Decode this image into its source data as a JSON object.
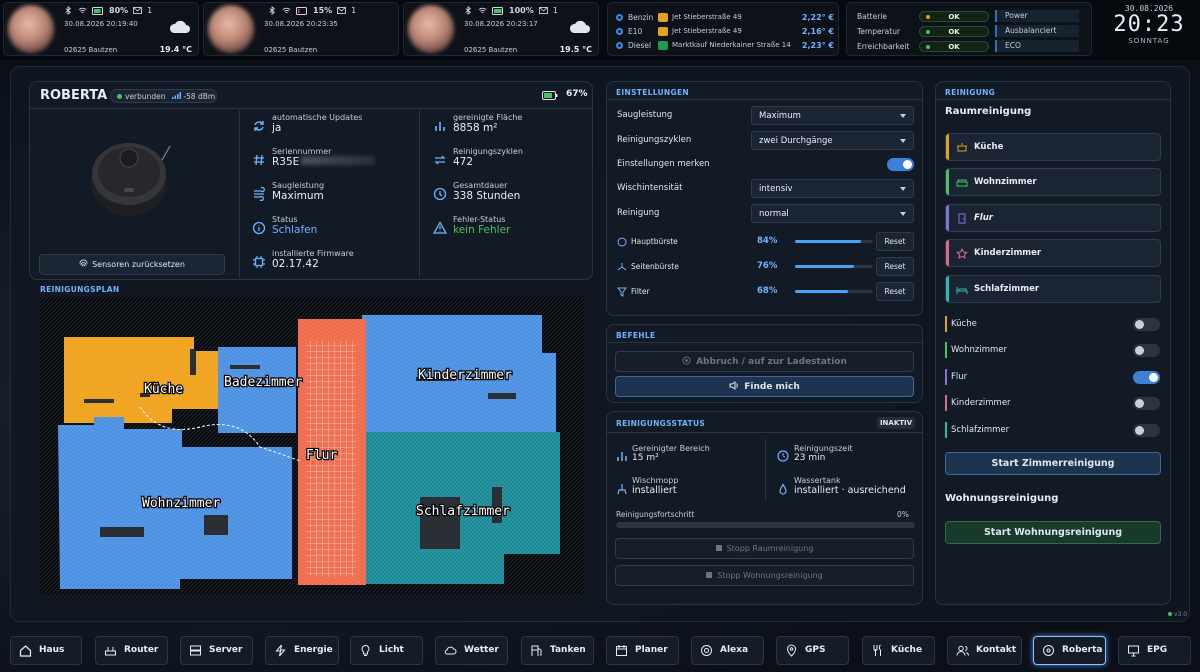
{
  "users": [
    {
      "battery": "80%",
      "mail": "1",
      "datetime": "30.08.2026 20:19:40",
      "location": "02625 Bautzen",
      "temperature": "19.4 °C"
    },
    {
      "battery": "15%",
      "mail": "1",
      "datetime": "30.08.2026 20:23:35",
      "location": "02625 Bautzen",
      "temperature": ""
    },
    {
      "battery": "100%",
      "mail": "1",
      "datetime": "30.08.2026 20:23:17",
      "location": "02625 Bautzen",
      "temperature": "19.5 °C"
    }
  ],
  "fuel": [
    {
      "kind": "Benzin",
      "station": "Jet Stieberstraße 49",
      "price": "2,22° €",
      "logo_color": "#e2a21e"
    },
    {
      "kind": "E10",
      "station": "Jet Stieberstraße 49",
      "price": "2,16° €",
      "logo_color": "#e2a21e"
    },
    {
      "kind": "Diesel",
      "station": "Marktkauf Niederkainer Straße 14",
      "price": "2,23° €",
      "logo_color": "#1e9e4a"
    }
  ],
  "system": {
    "rows": [
      {
        "label": "Batterie",
        "status": "OK",
        "dot": "#e2a21e",
        "mode": "Power"
      },
      {
        "label": "Temperatur",
        "status": "OK",
        "dot": "#49c35c",
        "mode": "Ausbalanciert"
      },
      {
        "label": "Erreichbarkeit",
        "status": "OK",
        "dot": "#49c35c",
        "mode": "ECO"
      }
    ]
  },
  "clock": {
    "date": "30.08.2026",
    "time": "20:23",
    "day": "SONNTAG"
  },
  "robot": {
    "name": "ROBERTA",
    "connection": "verbunden",
    "signal": "-58 dBm",
    "battery": "67%",
    "reset_sensors": "Sensoren zurücksetzen",
    "fields_left": [
      {
        "label": "automatische Updates",
        "value": "ja"
      },
      {
        "label": "Seriennummer",
        "value": "R35E"
      },
      {
        "label": "Saugleistung",
        "value": "Maximum"
      },
      {
        "label": "Status",
        "value": "Schlafen"
      },
      {
        "label": "installierte Firmware",
        "value": "02.17.42"
      }
    ],
    "fields_right": [
      {
        "label": "gereinigte Fläche",
        "value": "8858 m²"
      },
      {
        "label": "Reinigungszyklen",
        "value": "472"
      },
      {
        "label": "Gesamtdauer",
        "value": "338 Stunden"
      },
      {
        "label": "Fehler-Status",
        "value": "kein Fehler"
      }
    ]
  },
  "plan": {
    "title": "REINIGUNGSPLAN",
    "rooms": {
      "kueche": "Küche",
      "bad": "Badezimmer",
      "flur": "Flur",
      "kinder": "Kinderzimmer",
      "wohn": "Wohnzimmer",
      "schlaf": "Schlafzimmer"
    }
  },
  "settings": {
    "title": "EINSTELLUNGEN",
    "suction_label": "Saugleistung",
    "suction_value": "Maximum",
    "cycles_label": "Reinigungszyklen",
    "cycles_value": "zwei Durchgänge",
    "remember_label": "Einstellungen merken",
    "wipe_label": "Wischintensität",
    "wipe_value": "intensiv",
    "clean_label": "Reinigung",
    "clean_value": "normal",
    "consumables": [
      {
        "label": "Hauptbürste",
        "percent": "84%",
        "level": 84,
        "reset": "Reset"
      },
      {
        "label": "Seitenbürste",
        "percent": "76%",
        "level": 76,
        "reset": "Reset"
      },
      {
        "label": "Filter",
        "percent": "68%",
        "level": 68,
        "reset": "Reset"
      }
    ]
  },
  "commands": {
    "title": "BEFEHLE",
    "abort": "Abbruch / auf zur Ladestation",
    "locate": "Finde mich"
  },
  "status": {
    "title": "REINIGUNGSSTATUS",
    "badge": "INAKTIV",
    "area_label": "Gereinigter Bereich",
    "area_value": "15 m²",
    "time_label": "Reinigungszeit",
    "time_value": "23 min",
    "mop_label": "Wischmopp",
    "mop_value": "installiert",
    "tank_label": "Wassertank",
    "tank_value": "installiert · ausreichend",
    "progress_label": "Reinigungsfortschritt",
    "progress_value": "0%",
    "progress_level": 0,
    "stop_room": "Stopp Raumreinigung",
    "stop_flat": "Stopp Wohnungsreinigung"
  },
  "cleaning": {
    "title": "REINIGUNG",
    "room_heading": "Raumreinigung",
    "room_buttons": [
      {
        "label": "Küche",
        "color": "#e2a21e"
      },
      {
        "label": "Wohnzimmer",
        "color": "#49c35c"
      },
      {
        "label": "Flur",
        "color": "#8a6ee0"
      },
      {
        "label": "Kinderzimmer",
        "color": "#e06a86"
      },
      {
        "label": "Schlafzimmer",
        "color": "#2fb8b0"
      }
    ],
    "room_toggles": [
      {
        "label": "Küche",
        "color": "#e2a21e",
        "on": false
      },
      {
        "label": "Wohnzimmer",
        "color": "#49c35c",
        "on": false
      },
      {
        "label": "Flur",
        "color": "#8a6ee0",
        "on": true
      },
      {
        "label": "Kinderzimmer",
        "color": "#e06a86",
        "on": false
      },
      {
        "label": "Schlafzimmer",
        "color": "#2fb8b0",
        "on": false
      }
    ],
    "start_rooms": "Start Zimmerreinigung",
    "flat_heading": "Wohnungsreinigung",
    "start_flat": "Start Wohnungsreinigung"
  },
  "version": "v3.0",
  "nav": [
    {
      "label": "Haus",
      "icon": "home-icon"
    },
    {
      "label": "Router",
      "icon": "router-icon"
    },
    {
      "label": "Server",
      "icon": "server-icon"
    },
    {
      "label": "Energie",
      "icon": "lightning-icon"
    },
    {
      "label": "Licht",
      "icon": "bulb-icon"
    },
    {
      "label": "Wetter",
      "icon": "cloud-icon"
    },
    {
      "label": "Tanken",
      "icon": "fuel-icon"
    },
    {
      "label": "Planer",
      "icon": "calendar-icon"
    },
    {
      "label": "Alexa",
      "icon": "alexa-icon"
    },
    {
      "label": "GPS",
      "icon": "pin-icon"
    },
    {
      "label": "Küche",
      "icon": "cutlery-icon"
    },
    {
      "label": "Kontakt",
      "icon": "contacts-icon"
    },
    {
      "label": "Roberta",
      "icon": "robot-icon",
      "active": true
    },
    {
      "label": "EPG",
      "icon": "tv-icon"
    }
  ]
}
